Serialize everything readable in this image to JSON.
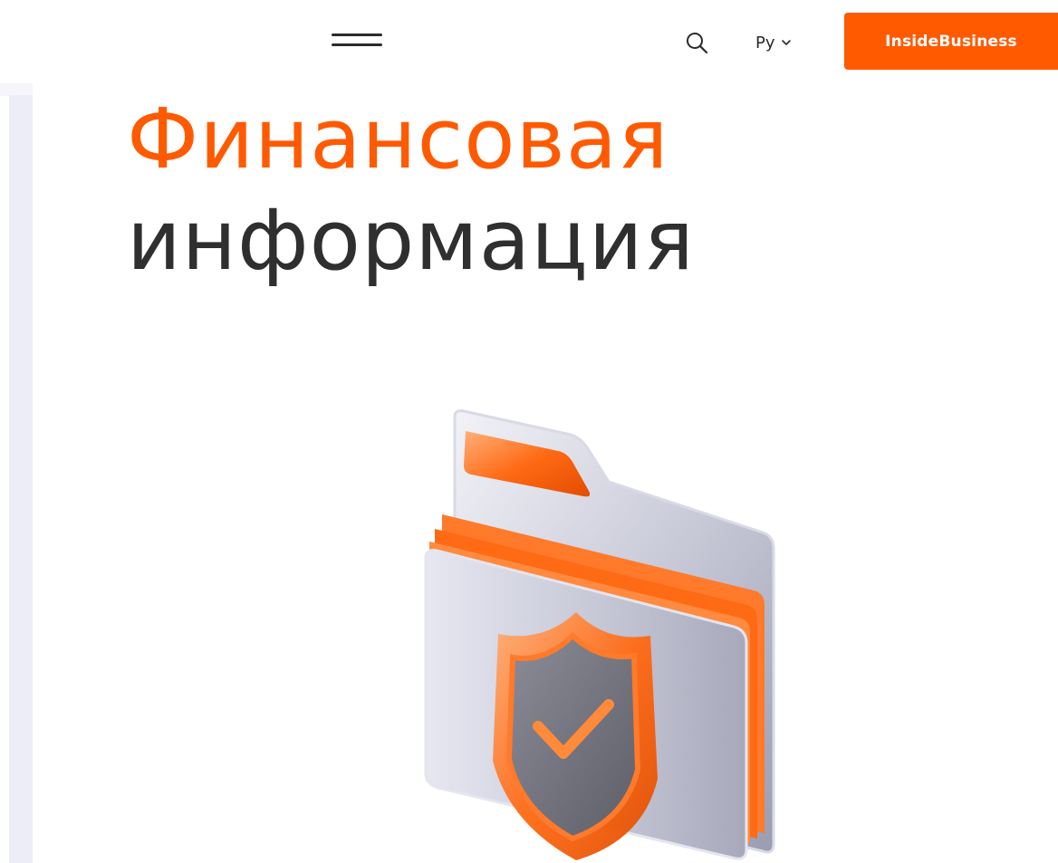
{
  "header": {
    "menu_icon": "hamburger-menu-icon",
    "search_icon": "search-icon",
    "language": {
      "selected": "Ру",
      "chevron_icon": "chevron-down-icon"
    },
    "cta_label": "InsideBusiness"
  },
  "hero": {
    "title_line1": "Финансовая",
    "title_line2": "информация",
    "illustration_icon": "secure-folder-shield-icon"
  },
  "colors": {
    "accent": "#ff5a00",
    "text": "#2f2f2f",
    "rail": "#ecedf6"
  }
}
